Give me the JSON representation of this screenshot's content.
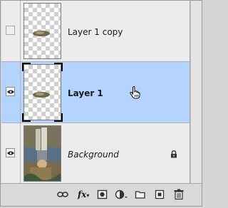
{
  "layers": [
    {
      "name": "Layer 1 copy",
      "visible": false,
      "selected": false,
      "locked": false,
      "thumbnail": "transparent-ellipse"
    },
    {
      "name": "Layer 1",
      "visible": true,
      "selected": true,
      "locked": false,
      "thumbnail": "transparent-ellipse"
    },
    {
      "name": "Background",
      "visible": true,
      "selected": false,
      "locked": true,
      "thumbnail": "photo-reflection"
    }
  ],
  "footer": {
    "fx_label": "fx",
    "buttons": [
      "link-layers-icon",
      "layer-style-icon",
      "layer-mask-icon",
      "adjustment-layer-icon",
      "new-group-icon",
      "new-layer-icon",
      "trash-icon"
    ]
  },
  "colors": {
    "selected_row": "#b4d4ff",
    "panel_bg": "#ececec"
  },
  "icons": {
    "visibility": "eye-icon",
    "lock": "lock-icon",
    "cursor": "hand-cursor-icon"
  }
}
